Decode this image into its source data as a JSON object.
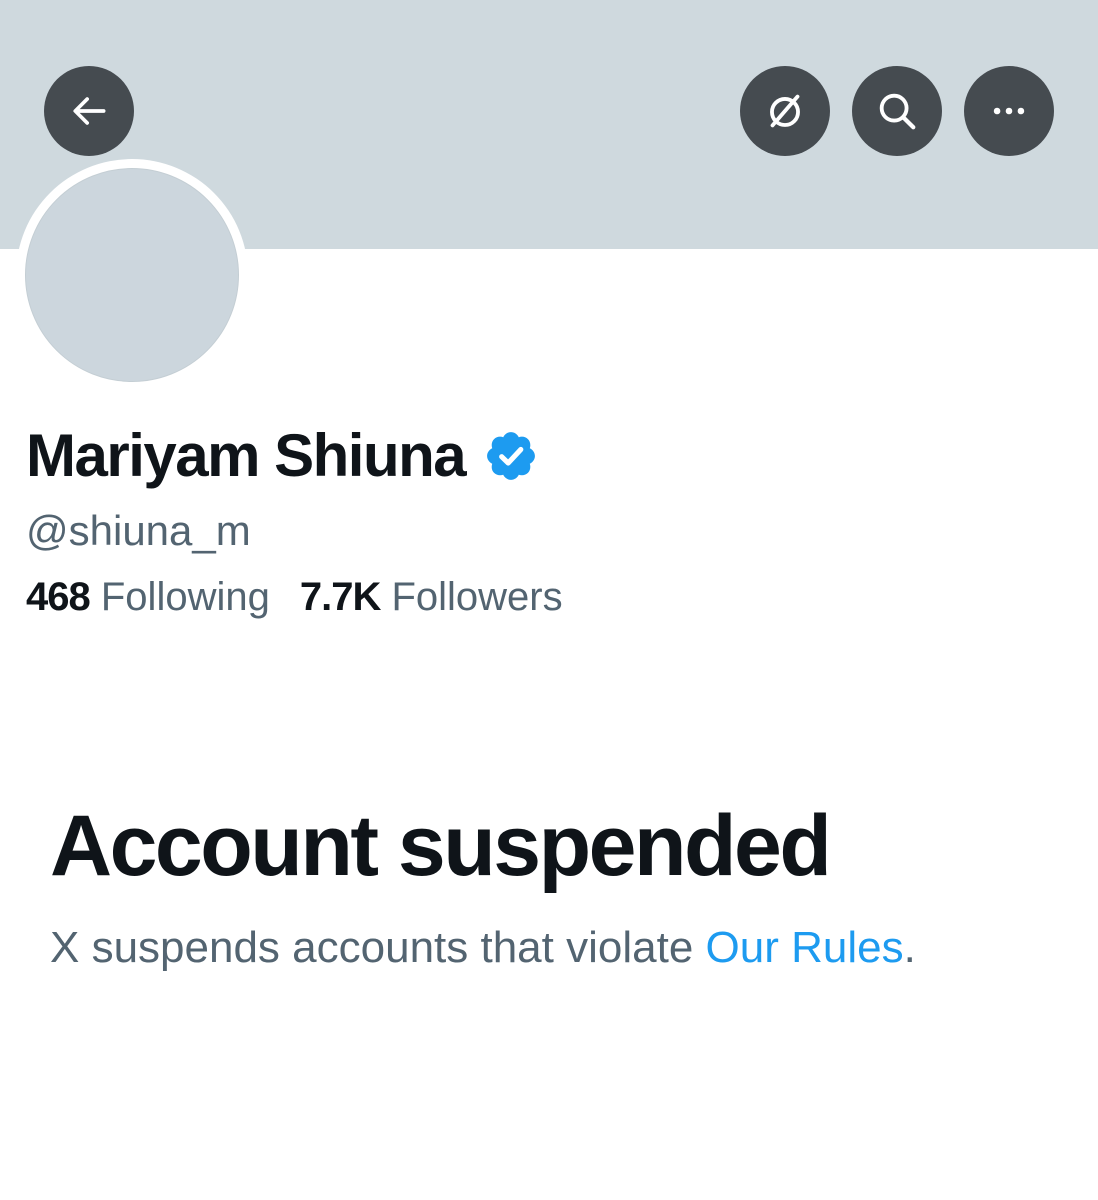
{
  "header": {
    "back_icon": "arrow-left-icon",
    "translate_icon": "translate-icon",
    "search_icon": "search-icon",
    "more_icon": "more-horizontal-icon",
    "banner_color": "#cfd9de"
  },
  "profile": {
    "display_name": "Mariyam Shiuna",
    "verified_icon": "verified-badge-icon",
    "verified_color": "#1d9bf0",
    "handle": "@shiuna_m",
    "following_count": "468",
    "following_label": "Following",
    "followers_count": "7.7K",
    "followers_label": "Followers"
  },
  "notice": {
    "title": "Account suspended",
    "text_before": "X suspends accounts that violate ",
    "link_text": "Our Rules",
    "text_after": ".",
    "link_color": "#1d9bf0"
  }
}
